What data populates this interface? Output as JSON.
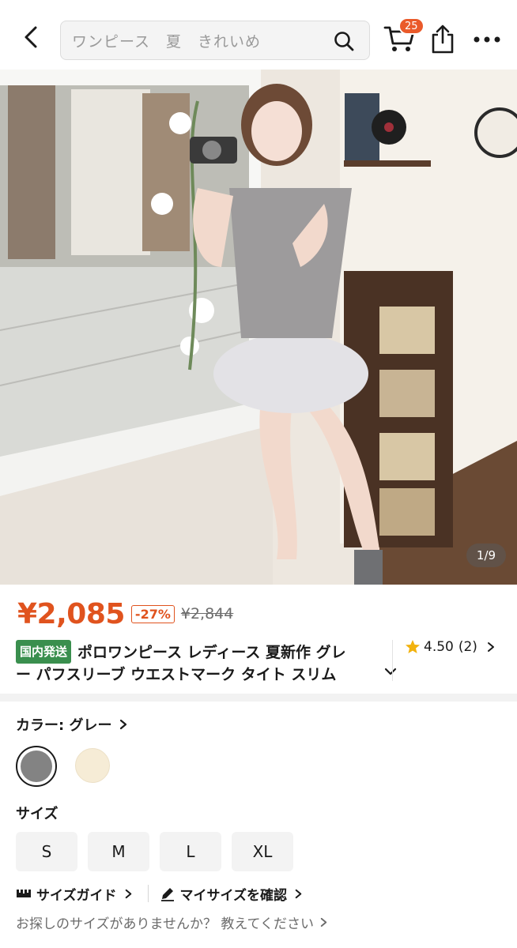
{
  "header": {
    "search_placeholder": "ワンピース　夏　きれいめ",
    "cart_count": "25"
  },
  "gallery": {
    "counter": "1/9"
  },
  "price": {
    "current": "¥2,085",
    "discount": "-27%",
    "original": "¥2,844"
  },
  "product": {
    "badge": "国内発送",
    "title_line1": "ポロワンピース レディース 夏新作 グレ",
    "title_line2": "ー パフスリーブ ウエストマーク タイト スリム",
    "rating": "4.50",
    "review_count": "(2)"
  },
  "color": {
    "label": "カラー: グレー",
    "options": [
      "grey",
      "cream"
    ],
    "selected_hex": "#838383",
    "other_hex": "#f6ecd6"
  },
  "size": {
    "label": "サイズ",
    "options": [
      "S",
      "M",
      "L",
      "XL"
    ]
  },
  "links": {
    "size_guide": "サイズガイド",
    "my_size": "マイサイズを確認",
    "ask": "お探しのサイズがありませんか？ 教えてください"
  },
  "colors": {
    "accent": "#e0531e",
    "badge_green": "#3a8f4e",
    "cart_badge": "#ea5a2a"
  }
}
